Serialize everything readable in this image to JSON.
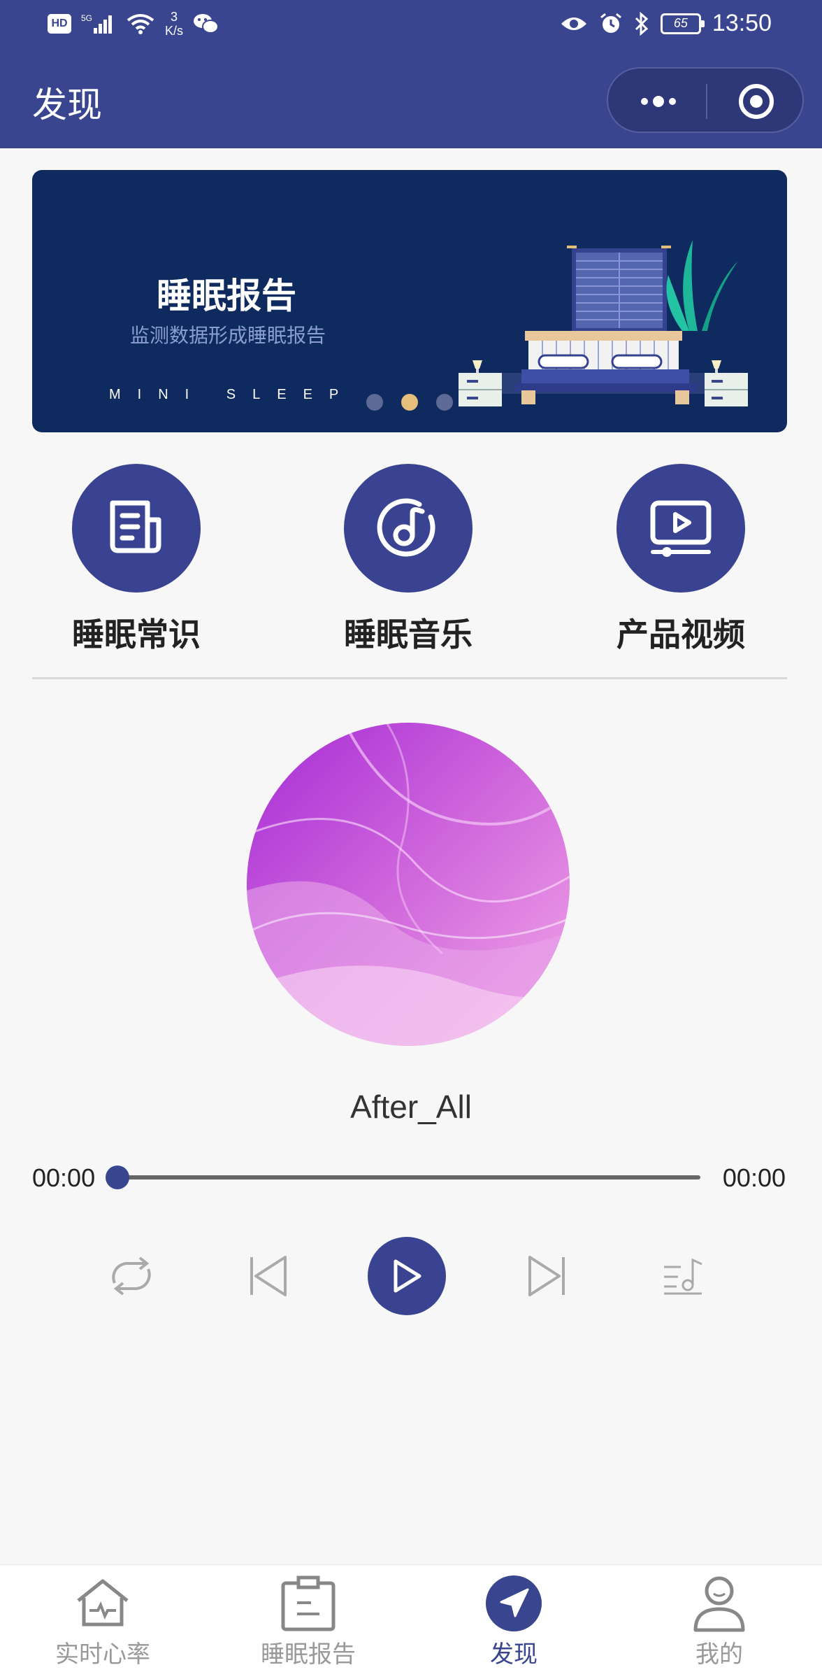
{
  "status_bar": {
    "hd": "HD",
    "network": "5G",
    "speed_value": "3",
    "speed_unit": "K/s",
    "battery": "65",
    "time": "13:50"
  },
  "header": {
    "title": "发现"
  },
  "banner": {
    "title": "睡眠报告",
    "subtitle": "监测数据形成睡眠报告",
    "brand": "MINI SLEEP",
    "slide_count": 3,
    "active_slide": 2
  },
  "categories": [
    {
      "label": "睡眠常识",
      "icon": "document-icon"
    },
    {
      "label": "睡眠音乐",
      "icon": "music-note-icon"
    },
    {
      "label": "产品视频",
      "icon": "video-icon"
    }
  ],
  "player": {
    "song_title": "After_All",
    "current_time": "00:00",
    "total_time": "00:00",
    "progress": 0
  },
  "tabs": [
    {
      "label": "实时心率",
      "icon": "heart-rate-home-icon",
      "active": false
    },
    {
      "label": "睡眠报告",
      "icon": "clipboard-icon",
      "active": false
    },
    {
      "label": "发现",
      "icon": "navigation-arrow-icon",
      "active": true
    },
    {
      "label": "我的",
      "icon": "user-icon",
      "active": false
    }
  ],
  "colors": {
    "primary": "#3a4590",
    "banner_bg": "#0e2a5f",
    "active_dot": "#e6be7c",
    "inactive_tab": "#999999"
  }
}
